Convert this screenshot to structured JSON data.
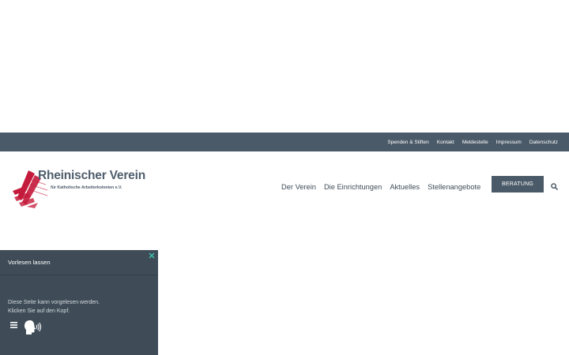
{
  "topbar": {
    "links": [
      "Spenden & Stiften",
      "Kontakt",
      "Meldestelle",
      "Impressum",
      "Datenschutz"
    ]
  },
  "header": {
    "logo": {
      "title": "Rheinischer Verein",
      "subtitle": "für Katholische Arbeiterkolonien e.V."
    },
    "nav": [
      "Der Verein",
      "Die Einrichtungen",
      "Aktuelles",
      "Stellenangebote"
    ],
    "cta_label": "BERATUNG"
  },
  "readpanel": {
    "title": "Vorlesen lassen",
    "line1": "Diese Seite kann vorgelesen werden.",
    "line2": "Klicken Sie auf den Kopf."
  },
  "colors": {
    "bar": "#4a5a68",
    "brand_red": "#c41a3b",
    "panel": "#3f4c57",
    "close_accent": "#3cc6b4"
  },
  "icons": [
    "logo-mark",
    "search-icon",
    "close-icon",
    "menu-icon",
    "speaking-head-icon"
  ]
}
